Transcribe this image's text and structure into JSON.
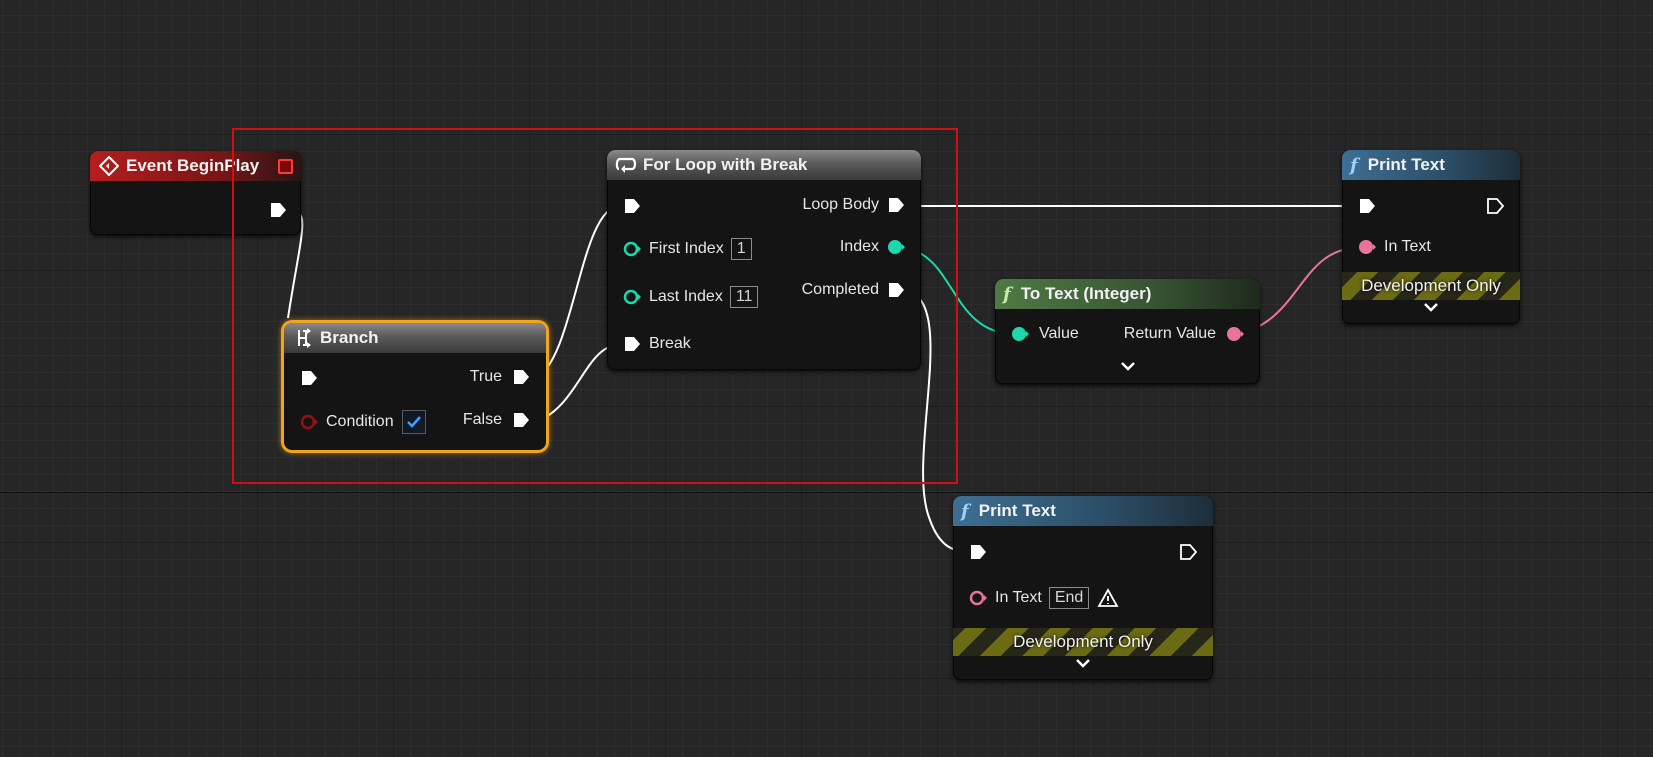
{
  "nodes": {
    "event_beginplay": {
      "title": "Event BeginPlay"
    },
    "branch": {
      "title": "Branch",
      "true_label": "True",
      "false_label": "False",
      "condition_label": "Condition",
      "condition_checked": true
    },
    "for_loop": {
      "title": "For Loop with Break",
      "first_index_label": "First Index",
      "first_index_value": "1",
      "last_index_label": "Last Index",
      "last_index_value": "11",
      "break_label": "Break",
      "loop_body_label": "Loop Body",
      "index_label": "Index",
      "completed_label": "Completed"
    },
    "to_text": {
      "title": "To Text (Integer)",
      "value_label": "Value",
      "return_label": "Return Value"
    },
    "print_text_top": {
      "title": "Print Text",
      "in_text_label": "In Text",
      "dev_only": "Development Only"
    },
    "print_text_bottom": {
      "title": "Print Text",
      "in_text_label": "In Text",
      "in_text_value": "End",
      "dev_only": "Development Only"
    }
  },
  "icons": {
    "event": "diamond-event-icon",
    "branch": "branch-icon",
    "loop": "loop-icon",
    "function": "function-f-icon",
    "warning": "warning-icon",
    "expand": "chevron-down-icon"
  },
  "colors": {
    "exec_wire": "#ffffff",
    "int_pin": "#1ed8a8",
    "text_pin": "#e8749c",
    "bool_pin": "#9a1010",
    "selection": "#d01010",
    "selected_node": "#f1a51e"
  }
}
